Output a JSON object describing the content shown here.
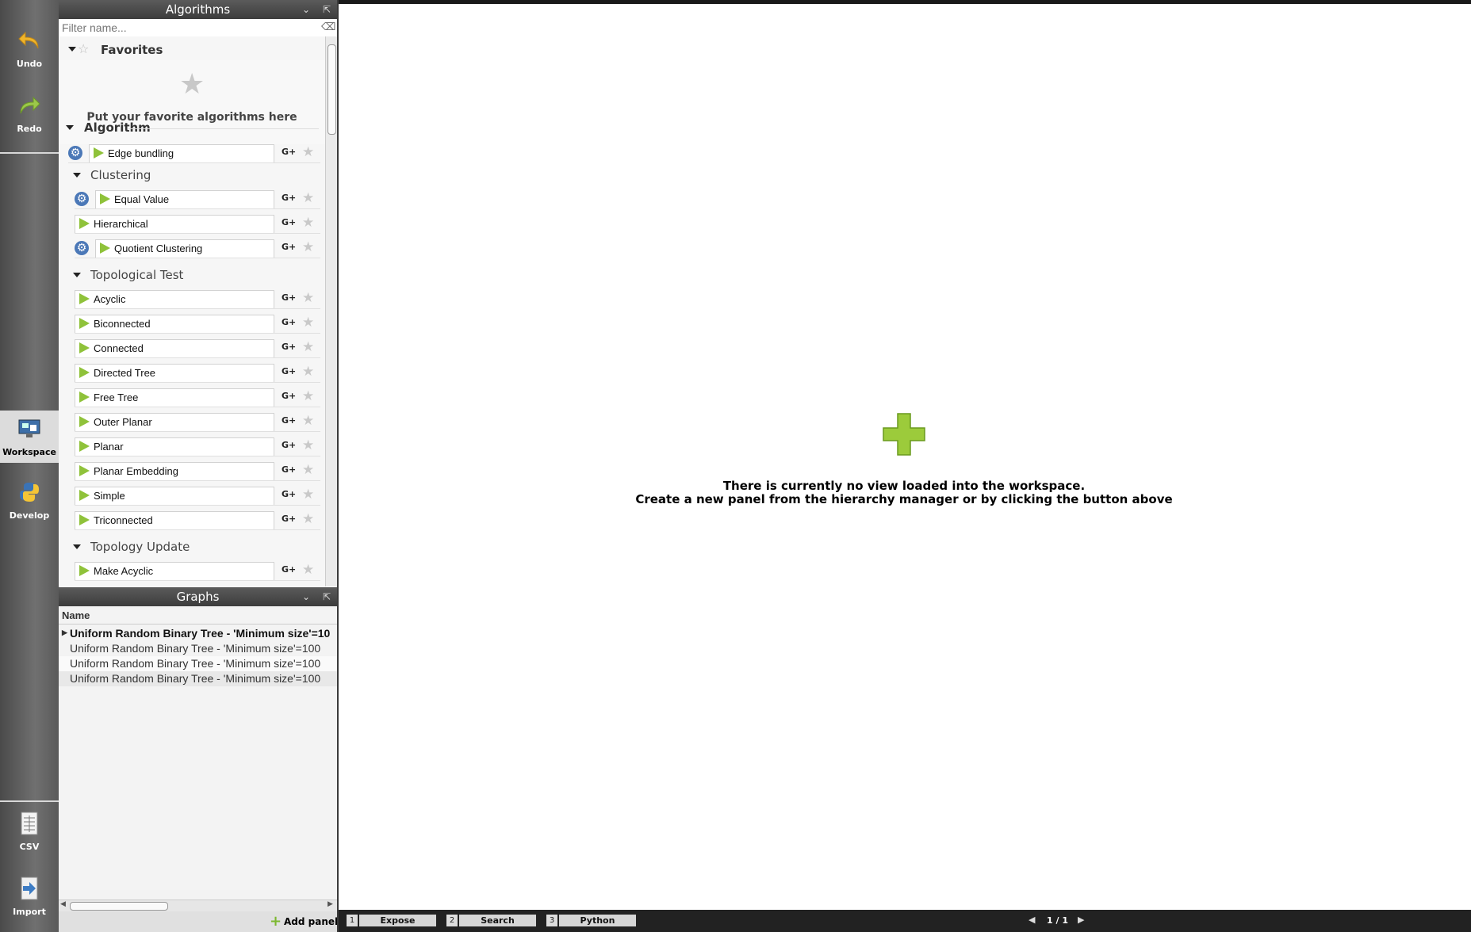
{
  "toolbar": {
    "undo": "Undo",
    "redo": "Redo",
    "workspace": "Workspace",
    "develop": "Develop",
    "csv": "CSV",
    "import": "Import"
  },
  "algorithms_panel": {
    "title": "Algorithms",
    "filter_placeholder": "Filter name...",
    "favorites": {
      "label": "Favorites",
      "hint": "Put your favorite algorithms here"
    },
    "algorithm_section": "Algorithm",
    "edge_bundling": "Edge bundling",
    "clustering": {
      "label": "Clustering",
      "items": [
        "Equal Value",
        "Hierarchical",
        "Quotient Clustering"
      ]
    },
    "topological_test": {
      "label": "Topological Test",
      "items": [
        "Acyclic",
        "Biconnected",
        "Connected",
        "Directed Tree",
        "Free Tree",
        "Outer Planar",
        "Planar",
        "Planar Embedding",
        "Simple",
        "Triconnected"
      ]
    },
    "topology_update": {
      "label": "Topology Update",
      "items": [
        "Make Acyclic"
      ]
    }
  },
  "graphs_panel": {
    "title": "Graphs",
    "column": "Name",
    "rows": [
      "Uniform Random Binary Tree - 'Minimum size'=10",
      "Uniform Random Binary Tree - 'Minimum size'=100",
      "Uniform Random Binary Tree - 'Minimum size'=100",
      "Uniform Random Binary Tree - 'Minimum size'=100"
    ],
    "add_panel": "Add panel"
  },
  "workspace": {
    "message_line1": "There is currently no view loaded into the workspace.",
    "message_line2": "Create a new panel from the hierarchy manager or by clicking the button above"
  },
  "bottom_bar": {
    "tabs": [
      {
        "num": "1",
        "label": "Expose"
      },
      {
        "num": "2",
        "label": "Search"
      },
      {
        "num": "3",
        "label": "Python"
      }
    ],
    "page": "1 / 1"
  },
  "colors": {
    "accent_green": "#8fc23a",
    "gear_blue": "#4b78b7"
  }
}
